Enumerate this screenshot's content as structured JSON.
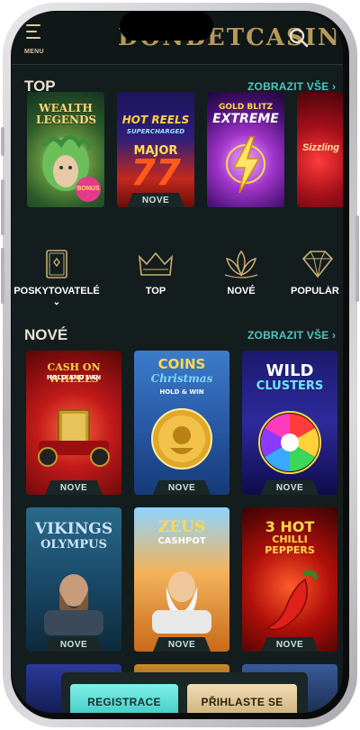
{
  "header": {
    "menu_label": "MENU",
    "logo_text": "DONBETCASINO"
  },
  "top": {
    "title": "TOP",
    "see_all": "ZOBRAZIT VŠE",
    "games": [
      {
        "name": "WEALTH LEGENDS",
        "badge": "",
        "provider_badge": "BONUS"
      },
      {
        "name": "HOT REELS",
        "sub": "SUPERCHARGED",
        "extra": "MAJOR",
        "badge": "NOVE"
      },
      {
        "name": "GOLD BLITZ",
        "sub": "EXTREME",
        "badge": ""
      },
      {
        "name": "Sizzling",
        "badge": ""
      }
    ]
  },
  "categories": [
    {
      "label": "POSKYTOVATELÉ",
      "icon": "providers-icon"
    },
    {
      "label": "TOP",
      "icon": "crown-icon"
    },
    {
      "label": "NOVÉ",
      "icon": "lotus-icon"
    },
    {
      "label": "POPULÁR",
      "icon": "diamond-icon"
    }
  ],
  "new": {
    "title": "NOVÉ",
    "see_all": "ZOBRAZIT VŠE",
    "games": [
      {
        "name": "CASH ON WHEELS",
        "sub": "HOLD AND WIN",
        "badge": "NOVE"
      },
      {
        "name": "COINS",
        "sub": "Christmas",
        "extra": "HOLD & WIN",
        "badge": "NOVE"
      },
      {
        "name": "WILD",
        "sub": "CLUSTERS",
        "badge": "NOVE"
      },
      {
        "name": "VIKINGS",
        "sub": "OLYMPUS",
        "badge": "NOVE"
      },
      {
        "name": "ZEUS",
        "sub": "CASHPOT",
        "badge": "NOVE"
      },
      {
        "name": "3 HOT",
        "sub": "CHILLI PEPPERS",
        "badge": "NOVE"
      }
    ]
  },
  "cta": {
    "register": "REGISTRACE",
    "login": "PŘIHLASTE SE"
  },
  "colors": {
    "accent_teal": "#4fc6bf",
    "gold": "#b79a5c",
    "background": "#141d1d"
  }
}
